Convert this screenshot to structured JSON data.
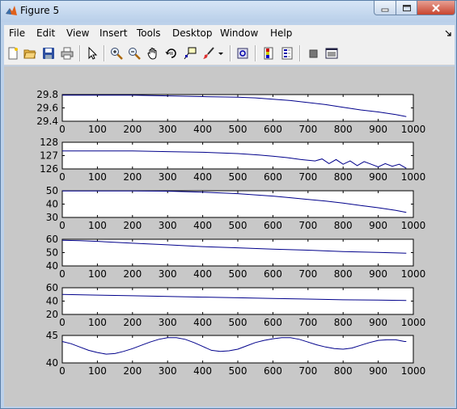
{
  "window": {
    "title": "Figure 5"
  },
  "menu": [
    "File",
    "Edit",
    "View",
    "Insert",
    "Tools",
    "Desktop",
    "Window",
    "Help"
  ],
  "toolbar": [
    "new-figure",
    "open-file",
    "save",
    "print",
    "pointer",
    "zoom-in",
    "zoom-out",
    "pan",
    "rotate-3d",
    "data-cursor",
    "brush",
    "link-plot",
    "colorbar",
    "legend",
    "hide-plot-tools",
    "show-plot-tools"
  ],
  "colors": {
    "line": "#00008b"
  },
  "chart_data": [
    {
      "type": "line",
      "xlim": [
        0,
        1000
      ],
      "ylim": [
        29.4,
        29.8
      ],
      "xticks": [
        0,
        100,
        200,
        300,
        400,
        500,
        600,
        700,
        800,
        900,
        1000
      ],
      "yticks": [
        "29.8",
        "29.6",
        "29.4"
      ],
      "series": [
        {
          "x": [
            0,
            100,
            200,
            300,
            400,
            500,
            550,
            600,
            650,
            700,
            750,
            800,
            850,
            900,
            950,
            980
          ],
          "y": [
            29.79,
            29.79,
            29.79,
            29.78,
            29.77,
            29.76,
            29.75,
            29.73,
            29.71,
            29.68,
            29.65,
            29.61,
            29.57,
            29.54,
            29.5,
            29.47
          ]
        }
      ]
    },
    {
      "type": "line",
      "xlim": [
        0,
        1000
      ],
      "ylim": [
        126,
        128
      ],
      "xticks": [
        0,
        100,
        200,
        300,
        400,
        500,
        600,
        700,
        800,
        900,
        1000
      ],
      "yticks": [
        "128",
        "127",
        "126"
      ],
      "series": [
        {
          "x": [
            0,
            100,
            200,
            300,
            400,
            500,
            560,
            600,
            640,
            680,
            720,
            740,
            760,
            780,
            800,
            820,
            840,
            860,
            880,
            900,
            920,
            940,
            960,
            980
          ],
          "y": [
            127.35,
            127.35,
            127.35,
            127.3,
            127.25,
            127.15,
            127.05,
            126.95,
            126.85,
            126.7,
            126.6,
            126.75,
            126.4,
            126.7,
            126.35,
            126.6,
            126.25,
            126.55,
            126.35,
            126.15,
            126.4,
            126.2,
            126.35,
            126.05
          ]
        }
      ]
    },
    {
      "type": "line",
      "xlim": [
        0,
        1000
      ],
      "ylim": [
        30,
        50
      ],
      "xticks": [
        0,
        100,
        200,
        300,
        400,
        500,
        600,
        700,
        800,
        900,
        1000
      ],
      "yticks": [
        "50",
        "40",
        "30"
      ],
      "series": [
        {
          "x": [
            0,
            100,
            200,
            300,
            400,
            500,
            600,
            650,
            700,
            750,
            800,
            850,
            900,
            950,
            980
          ],
          "y": [
            49.8,
            49.8,
            49.8,
            49.7,
            49,
            47.8,
            46,
            44.8,
            43.5,
            42.3,
            40.8,
            39,
            37.3,
            35.3,
            33.8
          ]
        }
      ]
    },
    {
      "type": "line",
      "xlim": [
        0,
        1000
      ],
      "ylim": [
        40,
        60
      ],
      "xticks": [
        0,
        100,
        200,
        300,
        400,
        500,
        600,
        700,
        800,
        900,
        1000
      ],
      "yticks": [
        "60",
        "50",
        "40"
      ],
      "series": [
        {
          "x": [
            0,
            50,
            100,
            200,
            300,
            400,
            500,
            600,
            700,
            800,
            900,
            980
          ],
          "y": [
            59.2,
            58.9,
            58.4,
            57,
            55.8,
            54.5,
            53.6,
            52.6,
            51.8,
            50.8,
            50.2,
            49.5
          ]
        }
      ]
    },
    {
      "type": "line",
      "xlim": [
        0,
        1000
      ],
      "ylim": [
        20,
        60
      ],
      "xticks": [
        0,
        100,
        200,
        300,
        400,
        500,
        600,
        700,
        800,
        900,
        1000
      ],
      "yticks": [
        "60",
        "40",
        "20"
      ],
      "series": [
        {
          "x": [
            0,
            100,
            200,
            300,
            400,
            500,
            600,
            700,
            800,
            900,
            980
          ],
          "y": [
            50,
            49,
            48,
            47,
            46,
            45,
            44,
            43,
            42,
            41.5,
            41
          ]
        }
      ]
    },
    {
      "type": "line",
      "xlim": [
        0,
        1000
      ],
      "ylim": [
        40,
        45
      ],
      "xticks": [
        0,
        100,
        200,
        300,
        400,
        500,
        600,
        700,
        800,
        900,
        1000
      ],
      "yticks": [
        "45",
        "40"
      ],
      "series": [
        {
          "x": [
            0,
            25,
            50,
            75,
            100,
            125,
            150,
            175,
            200,
            225,
            250,
            275,
            300,
            325,
            350,
            375,
            400,
            425,
            450,
            475,
            500,
            525,
            550,
            575,
            600,
            625,
            650,
            675,
            700,
            725,
            750,
            775,
            800,
            825,
            850,
            875,
            900,
            925,
            950,
            975,
            980
          ],
          "y": [
            43.9,
            43.5,
            42.9,
            42.3,
            41.9,
            41.6,
            41.7,
            42.1,
            42.6,
            43.2,
            43.8,
            44.3,
            44.6,
            44.6,
            44.3,
            43.7,
            43,
            42.3,
            42.1,
            42.2,
            42.5,
            43.1,
            43.7,
            44.1,
            44.4,
            44.6,
            44.6,
            44.3,
            43.8,
            43.3,
            42.9,
            42.6,
            42.5,
            42.7,
            43.2,
            43.7,
            44.1,
            44.2,
            44.2,
            43.9,
            43.9
          ]
        }
      ]
    }
  ]
}
